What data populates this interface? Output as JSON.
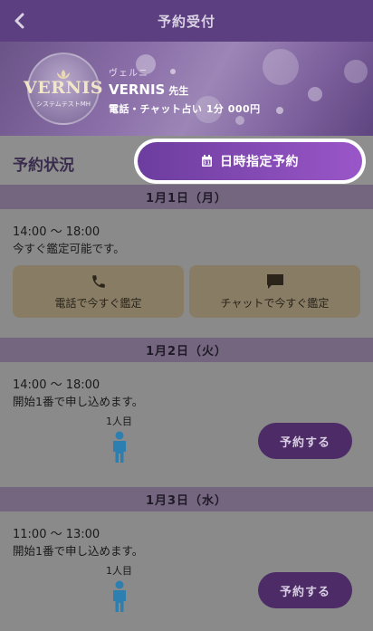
{
  "header": {
    "title": "予約受付",
    "back_icon": "chevron-left-icon"
  },
  "teacher": {
    "logo_text": "VERNIS",
    "logo_sub": "システムテストMH",
    "kana": "ヴェルニ",
    "name": "VERNIS",
    "honorific": "先生",
    "price_line": "電話・チャット占い 1分 000円"
  },
  "status": {
    "label": "予約状況",
    "date_button_label": "日時指定予約",
    "date_button_icon": "calendar-icon"
  },
  "days": [
    {
      "date": "1月1日（月）",
      "time": "14:00 〜 18:00",
      "note": "今すぐ鑑定可能です。",
      "phone_label": "電話で今すぐ鑑定",
      "chat_label": "チャットで今すぐ鑑定"
    },
    {
      "date": "1月2日（火）",
      "time": "14:00 〜 18:00",
      "note": "開始1番で申し込めます。",
      "queue_label": "1人目",
      "reserve_label": "予約する"
    },
    {
      "date": "1月3日（水）",
      "time": "11:00 〜 13:00",
      "note": "開始1番で申し込めます。",
      "queue_label": "1人目",
      "reserve_label": "予約する"
    }
  ],
  "colors": {
    "header_bg": "#5c3f80",
    "accent_gradient_start": "#6c3d9e",
    "accent_gradient_end": "#9a56c8",
    "day_header_bg": "#74667f",
    "action_button_bg": "#887c64",
    "reserve_button_bg": "#4c2b66",
    "person_icon": "#2d7fb0"
  }
}
